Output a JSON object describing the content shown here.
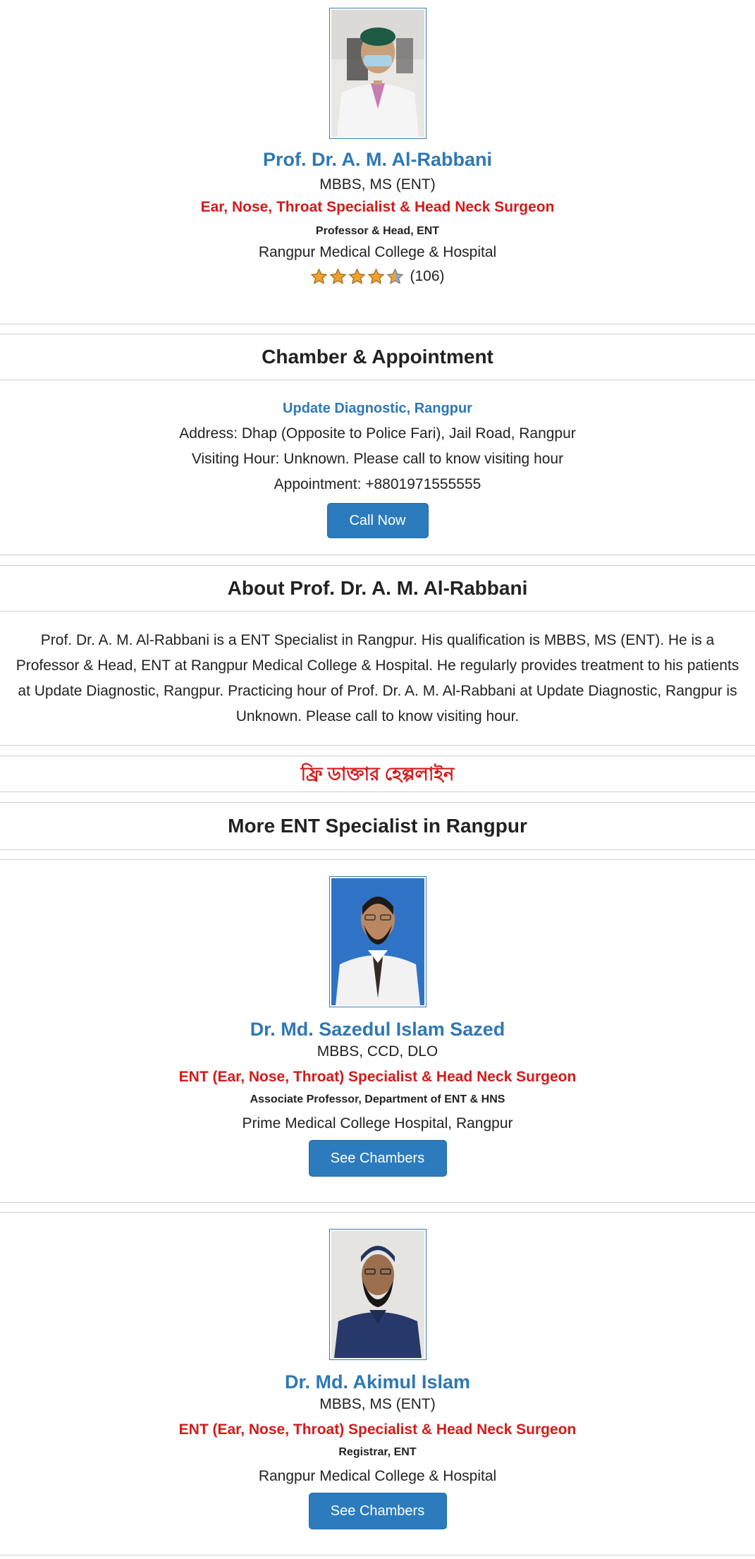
{
  "doctor": {
    "name": "Prof. Dr. A. M. Al-Rabbani",
    "degree": "MBBS, MS (ENT)",
    "specialty": "Ear, Nose, Throat Specialist & Head Neck Surgeon",
    "position": "Professor & Head, ENT",
    "institute": "Rangpur Medical College & Hospital",
    "rating_stars": 4.5,
    "rating_count": "(106)"
  },
  "chamber": {
    "heading": "Chamber & Appointment",
    "name": "Update Diagnostic, Rangpur",
    "address": "Address: Dhap (Opposite to Police Fari), Jail Road, Rangpur",
    "visiting_hour": "Visiting Hour: Unknown. Please call to know visiting hour",
    "appointment": "Appointment: +8801971555555",
    "call_button": "Call Now"
  },
  "about": {
    "heading": "About Prof. Dr. A. M. Al-Rabbani",
    "text": "Prof. Dr. A. M. Al-Rabbani is a ENT Specialist in Rangpur. His qualification is MBBS, MS (ENT). He is a Professor & Head, ENT at Rangpur Medical College & Hospital. He regularly provides treatment to his patients at Update Diagnostic, Rangpur. Practicing hour of Prof. Dr. A. M. Al-Rabbani at Update Diagnostic, Rangpur is Unknown. Please call to know visiting hour."
  },
  "helpline": {
    "label": "ফ্রি ডাক্তার হেল্পলাইন"
  },
  "more": {
    "heading": "More ENT Specialist in Rangpur",
    "doctors": [
      {
        "name": "Dr. Md. Sazedul Islam Sazed",
        "degree": "MBBS, CCD, DLO",
        "specialty": "ENT (Ear, Nose, Throat) Specialist & Head Neck Surgeon",
        "position": "Associate Professor, Department of ENT & HNS",
        "institute": "Prime Medical College Hospital, Rangpur",
        "button": "See Chambers"
      },
      {
        "name": "Dr. Md. Akimul Islam",
        "degree": "MBBS, MS (ENT)",
        "specialty": "ENT (Ear, Nose, Throat) Specialist & Head Neck Surgeon",
        "position": "Registrar, ENT",
        "institute": "Rangpur Medical College & Hospital",
        "button": "See Chambers"
      }
    ]
  },
  "colors": {
    "name_blue": "#2e78b5",
    "specialty_red": "#d41a1a",
    "button_blue": "#2b7bbd"
  }
}
